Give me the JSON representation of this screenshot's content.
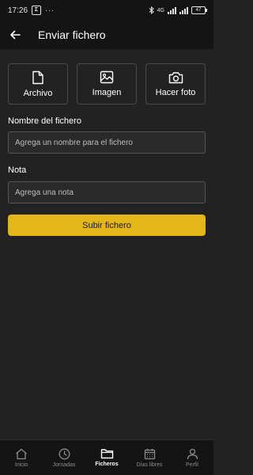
{
  "status_bar": {
    "time": "17:26",
    "notification_badge": "Σ",
    "dots": "···",
    "network": "4G",
    "battery": "47"
  },
  "app_bar": {
    "title": "Enviar fichero",
    "back_icon": "arrow-left-icon"
  },
  "upload_options": [
    {
      "label": "Archivo",
      "icon": "file-icon"
    },
    {
      "label": "Imagen",
      "icon": "image-icon"
    },
    {
      "label": "Hacer foto",
      "icon": "camera-icon"
    }
  ],
  "form": {
    "filename_label": "Nombre del fichero",
    "filename_placeholder": "Agrega un nombre para el fichero",
    "filename_value": "",
    "note_label": "Nota",
    "note_placeholder": "Agrega una nota",
    "note_value": "",
    "submit_label": "Subir fichero"
  },
  "bottom_nav": [
    {
      "label": "Inicio",
      "icon": "home-icon",
      "active": false
    },
    {
      "label": "Jornadas",
      "icon": "clock-icon",
      "active": false
    },
    {
      "label": "Ficheros",
      "icon": "folder-icon",
      "active": true
    },
    {
      "label": "Días libres",
      "icon": "calendar-icon",
      "active": false
    },
    {
      "label": "Perfil",
      "icon": "user-icon",
      "active": false
    }
  ],
  "colors": {
    "background": "#222222",
    "bars": "#141414",
    "accent": "#e4b719",
    "border": "#4a4a4a"
  }
}
